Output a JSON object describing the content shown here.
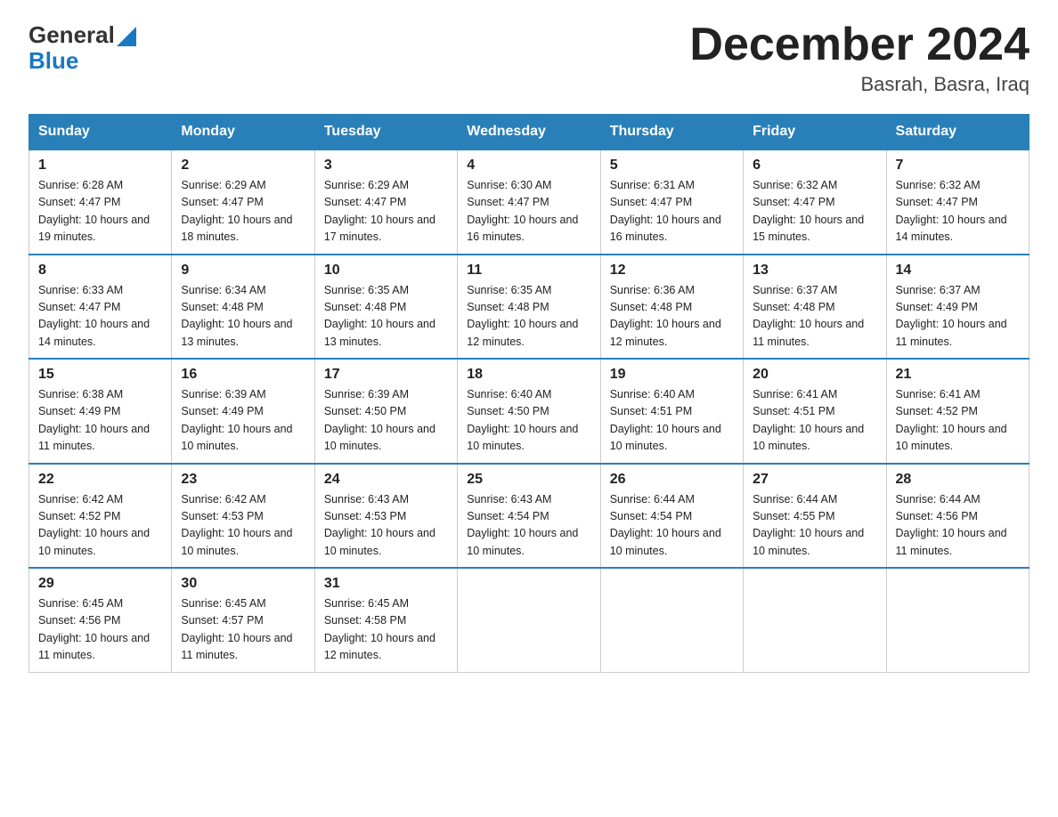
{
  "header": {
    "logo_line1": "General",
    "logo_line2": "Blue",
    "title": "December 2024",
    "location": "Basrah, Basra, Iraq"
  },
  "weekdays": [
    "Sunday",
    "Monday",
    "Tuesday",
    "Wednesday",
    "Thursday",
    "Friday",
    "Saturday"
  ],
  "weeks": [
    [
      {
        "day": "1",
        "sunrise": "Sunrise: 6:28 AM",
        "sunset": "Sunset: 4:47 PM",
        "daylight": "Daylight: 10 hours and 19 minutes."
      },
      {
        "day": "2",
        "sunrise": "Sunrise: 6:29 AM",
        "sunset": "Sunset: 4:47 PM",
        "daylight": "Daylight: 10 hours and 18 minutes."
      },
      {
        "day": "3",
        "sunrise": "Sunrise: 6:29 AM",
        "sunset": "Sunset: 4:47 PM",
        "daylight": "Daylight: 10 hours and 17 minutes."
      },
      {
        "day": "4",
        "sunrise": "Sunrise: 6:30 AM",
        "sunset": "Sunset: 4:47 PM",
        "daylight": "Daylight: 10 hours and 16 minutes."
      },
      {
        "day": "5",
        "sunrise": "Sunrise: 6:31 AM",
        "sunset": "Sunset: 4:47 PM",
        "daylight": "Daylight: 10 hours and 16 minutes."
      },
      {
        "day": "6",
        "sunrise": "Sunrise: 6:32 AM",
        "sunset": "Sunset: 4:47 PM",
        "daylight": "Daylight: 10 hours and 15 minutes."
      },
      {
        "day": "7",
        "sunrise": "Sunrise: 6:32 AM",
        "sunset": "Sunset: 4:47 PM",
        "daylight": "Daylight: 10 hours and 14 minutes."
      }
    ],
    [
      {
        "day": "8",
        "sunrise": "Sunrise: 6:33 AM",
        "sunset": "Sunset: 4:47 PM",
        "daylight": "Daylight: 10 hours and 14 minutes."
      },
      {
        "day": "9",
        "sunrise": "Sunrise: 6:34 AM",
        "sunset": "Sunset: 4:48 PM",
        "daylight": "Daylight: 10 hours and 13 minutes."
      },
      {
        "day": "10",
        "sunrise": "Sunrise: 6:35 AM",
        "sunset": "Sunset: 4:48 PM",
        "daylight": "Daylight: 10 hours and 13 minutes."
      },
      {
        "day": "11",
        "sunrise": "Sunrise: 6:35 AM",
        "sunset": "Sunset: 4:48 PM",
        "daylight": "Daylight: 10 hours and 12 minutes."
      },
      {
        "day": "12",
        "sunrise": "Sunrise: 6:36 AM",
        "sunset": "Sunset: 4:48 PM",
        "daylight": "Daylight: 10 hours and 12 minutes."
      },
      {
        "day": "13",
        "sunrise": "Sunrise: 6:37 AM",
        "sunset": "Sunset: 4:48 PM",
        "daylight": "Daylight: 10 hours and 11 minutes."
      },
      {
        "day": "14",
        "sunrise": "Sunrise: 6:37 AM",
        "sunset": "Sunset: 4:49 PM",
        "daylight": "Daylight: 10 hours and 11 minutes."
      }
    ],
    [
      {
        "day": "15",
        "sunrise": "Sunrise: 6:38 AM",
        "sunset": "Sunset: 4:49 PM",
        "daylight": "Daylight: 10 hours and 11 minutes."
      },
      {
        "day": "16",
        "sunrise": "Sunrise: 6:39 AM",
        "sunset": "Sunset: 4:49 PM",
        "daylight": "Daylight: 10 hours and 10 minutes."
      },
      {
        "day": "17",
        "sunrise": "Sunrise: 6:39 AM",
        "sunset": "Sunset: 4:50 PM",
        "daylight": "Daylight: 10 hours and 10 minutes."
      },
      {
        "day": "18",
        "sunrise": "Sunrise: 6:40 AM",
        "sunset": "Sunset: 4:50 PM",
        "daylight": "Daylight: 10 hours and 10 minutes."
      },
      {
        "day": "19",
        "sunrise": "Sunrise: 6:40 AM",
        "sunset": "Sunset: 4:51 PM",
        "daylight": "Daylight: 10 hours and 10 minutes."
      },
      {
        "day": "20",
        "sunrise": "Sunrise: 6:41 AM",
        "sunset": "Sunset: 4:51 PM",
        "daylight": "Daylight: 10 hours and 10 minutes."
      },
      {
        "day": "21",
        "sunrise": "Sunrise: 6:41 AM",
        "sunset": "Sunset: 4:52 PM",
        "daylight": "Daylight: 10 hours and 10 minutes."
      }
    ],
    [
      {
        "day": "22",
        "sunrise": "Sunrise: 6:42 AM",
        "sunset": "Sunset: 4:52 PM",
        "daylight": "Daylight: 10 hours and 10 minutes."
      },
      {
        "day": "23",
        "sunrise": "Sunrise: 6:42 AM",
        "sunset": "Sunset: 4:53 PM",
        "daylight": "Daylight: 10 hours and 10 minutes."
      },
      {
        "day": "24",
        "sunrise": "Sunrise: 6:43 AM",
        "sunset": "Sunset: 4:53 PM",
        "daylight": "Daylight: 10 hours and 10 minutes."
      },
      {
        "day": "25",
        "sunrise": "Sunrise: 6:43 AM",
        "sunset": "Sunset: 4:54 PM",
        "daylight": "Daylight: 10 hours and 10 minutes."
      },
      {
        "day": "26",
        "sunrise": "Sunrise: 6:44 AM",
        "sunset": "Sunset: 4:54 PM",
        "daylight": "Daylight: 10 hours and 10 minutes."
      },
      {
        "day": "27",
        "sunrise": "Sunrise: 6:44 AM",
        "sunset": "Sunset: 4:55 PM",
        "daylight": "Daylight: 10 hours and 10 minutes."
      },
      {
        "day": "28",
        "sunrise": "Sunrise: 6:44 AM",
        "sunset": "Sunset: 4:56 PM",
        "daylight": "Daylight: 10 hours and 11 minutes."
      }
    ],
    [
      {
        "day": "29",
        "sunrise": "Sunrise: 6:45 AM",
        "sunset": "Sunset: 4:56 PM",
        "daylight": "Daylight: 10 hours and 11 minutes."
      },
      {
        "day": "30",
        "sunrise": "Sunrise: 6:45 AM",
        "sunset": "Sunset: 4:57 PM",
        "daylight": "Daylight: 10 hours and 11 minutes."
      },
      {
        "day": "31",
        "sunrise": "Sunrise: 6:45 AM",
        "sunset": "Sunset: 4:58 PM",
        "daylight": "Daylight: 10 hours and 12 minutes."
      },
      null,
      null,
      null,
      null
    ]
  ]
}
